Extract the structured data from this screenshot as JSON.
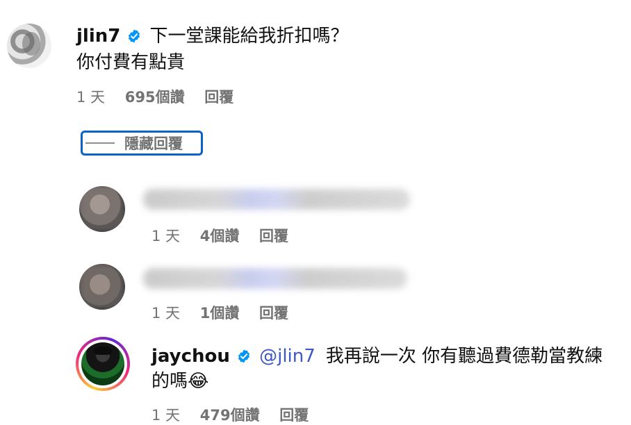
{
  "comments": [
    {
      "username": "jlin7",
      "verified": true,
      "text_line1": "下一堂課能給我折扣嗎？",
      "text_line2": "你付費有點貴",
      "time": "1 天",
      "likes": "695個讚",
      "reply": "回覆"
    },
    {
      "username": "jaychou",
      "verified": true,
      "mention": "@jlin7",
      "text_line1": "我再說一次 你有聽過費德勒當教練",
      "text_line2": "的嗎😂",
      "time": "1 天",
      "likes": "479個讚",
      "reply": "回覆"
    }
  ],
  "hide_replies": "隱藏回覆",
  "redacted_replies": [
    {
      "time": "1 天",
      "likes": "4個讚",
      "reply": "回覆"
    },
    {
      "time": "1 天",
      "likes": "1個讚",
      "reply": "回覆"
    }
  ],
  "colors": {
    "verified_blue": "#0095f6",
    "mention_blue": "#3d57c9",
    "meta_gray": "#737373",
    "focus_outline": "#0a62c9"
  }
}
